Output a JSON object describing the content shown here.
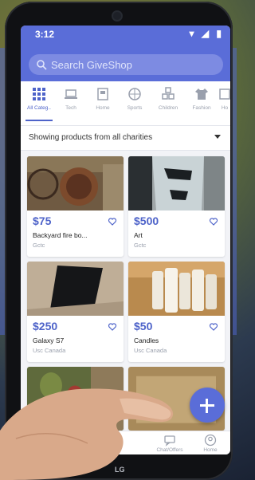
{
  "status": {
    "time": "3:12"
  },
  "search": {
    "placeholder": "Search GiveShop"
  },
  "categories": [
    {
      "label": "All Categ..",
      "icon": "grid-icon",
      "active": true
    },
    {
      "label": "Tech",
      "icon": "laptop-icon"
    },
    {
      "label": "Home",
      "icon": "home-icon"
    },
    {
      "label": "Sports",
      "icon": "ball-icon"
    },
    {
      "label": "Children",
      "icon": "blocks-icon"
    },
    {
      "label": "Fashion",
      "icon": "shirt-icon"
    },
    {
      "label": "Ho",
      "icon": "more-icon"
    }
  ],
  "filter": {
    "label": "Showing products from all charities"
  },
  "products": [
    {
      "price": "$75",
      "title": "Backyard fire bo...",
      "org": "Gctc"
    },
    {
      "price": "$500",
      "title": "Art",
      "org": "Gctc"
    },
    {
      "price": "$250",
      "title": "Galaxy S7",
      "org": "Usc Canada"
    },
    {
      "price": "$50",
      "title": "Candles",
      "org": "Usc Canada"
    }
  ],
  "nav": [
    {
      "label": "Chat/Offers",
      "icon": "chat-icon"
    },
    {
      "label": "Home",
      "icon": "profile-icon"
    }
  ],
  "brand": "LG",
  "colors": {
    "primary": "#5a6dd8",
    "accent": "#4e63c9"
  }
}
